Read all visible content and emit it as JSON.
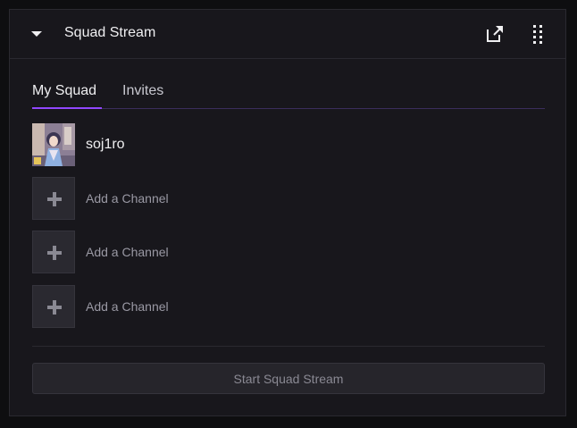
{
  "header": {
    "title": "Squad Stream",
    "collapse_icon": "caret-down-icon",
    "popout_icon": "popout-icon",
    "drag_icon": "drag-handle-icon"
  },
  "tabs": [
    {
      "label": "My Squad",
      "active": true
    },
    {
      "label": "Invites",
      "active": false
    }
  ],
  "squad": {
    "members": [
      {
        "name": "soj1ro"
      }
    ],
    "add_slots": [
      {
        "label": "Add a Channel"
      },
      {
        "label": "Add a Channel"
      },
      {
        "label": "Add a Channel"
      }
    ]
  },
  "actions": {
    "start_label": "Start Squad Stream"
  },
  "colors": {
    "accent": "#9147ff",
    "panel_bg": "#18171c",
    "text_primary": "#efeff1",
    "text_muted": "#9a99a4"
  }
}
